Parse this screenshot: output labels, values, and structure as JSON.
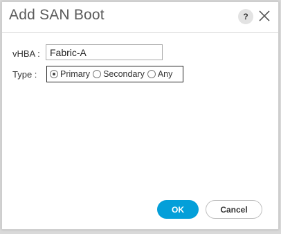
{
  "dialog": {
    "title": "Add SAN Boot",
    "help_label": "?",
    "vhba": {
      "label": "vHBA :",
      "value": "Fabric-A"
    },
    "type": {
      "label": "Type :",
      "options": [
        {
          "label": "Primary",
          "checked": true
        },
        {
          "label": "Secondary",
          "checked": false
        },
        {
          "label": "Any",
          "checked": false
        }
      ]
    },
    "buttons": {
      "ok": "OK",
      "cancel": "Cancel"
    }
  },
  "colors": {
    "accent": "#049fd9",
    "title": "#5a5a5a"
  },
  "icons": {
    "help": "help-icon",
    "close": "close-icon"
  }
}
